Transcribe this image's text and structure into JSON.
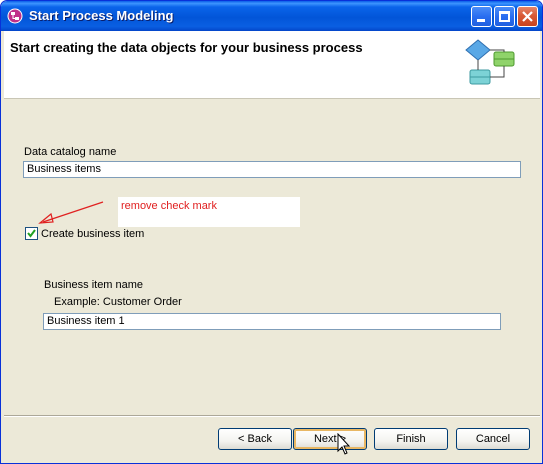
{
  "window": {
    "title": "Start Process Modeling",
    "app_icon": "process-modeler-icon"
  },
  "title_buttons": [
    "minimize-icon",
    "maximize-icon",
    "close-icon"
  ],
  "header": {
    "title": "Start creating the data objects for your business process",
    "graphic": "process-diagram-icon"
  },
  "form": {
    "catalog_label": "Data catalog name",
    "catalog_value": "Business items",
    "create_item_label": "Create business item",
    "create_item_checked": true,
    "item_name_label": "Business item name",
    "item_example": "Example: Customer Order",
    "item_name_value": "Business item 1"
  },
  "annotation": {
    "text": "remove check mark",
    "color": "#e02020"
  },
  "buttons": {
    "back": "< Back",
    "next": "Next >",
    "finish": "Finish",
    "cancel": "Cancel"
  },
  "colors": {
    "titlebar": "#0a5ee8",
    "dialog_bg": "#ece9d8",
    "default_button_glow": "#e8b764"
  }
}
